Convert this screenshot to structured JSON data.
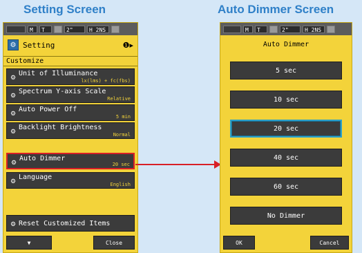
{
  "captions": {
    "left": "Setting Screen",
    "right": "Auto Dimmer Screen"
  },
  "colors": {
    "background": "#d5e7f7",
    "screen": "#f3d33a",
    "button": "#3b3b3b",
    "highlight": "#d81f26",
    "selected": "#2ca0c8",
    "caption": "#2f80c8"
  },
  "statusbar": {
    "mode": "M",
    "t": "T",
    "shutter": "2\"",
    "iso": "H 2NS"
  },
  "setting": {
    "title": "Setting",
    "title_icon": "setting-icon",
    "info_icon": "info-icon",
    "section": "Customize",
    "items": [
      {
        "label": "Unit of Illuminance",
        "value": "lx(lms) + fc(fbs)"
      },
      {
        "label": "Spectrum Y-axis Scale",
        "value": "Relative"
      },
      {
        "label": "Auto Power Off",
        "value": "5 min"
      },
      {
        "label": "Backlight Brightness",
        "value": "Normal"
      },
      {
        "label": "Auto Dimmer",
        "value": "20 sec"
      },
      {
        "label": "Language",
        "value": "English"
      }
    ],
    "reset_label": "Reset Customized Items",
    "down_button": "▼",
    "close_button": "Close"
  },
  "dimmer": {
    "title": "Auto Dimmer",
    "options": [
      "5 sec",
      "10 sec",
      "20 sec",
      "40 sec",
      "60 sec",
      "No Dimmer"
    ],
    "selected": "20 sec",
    "ok_button": "OK",
    "cancel_button": "Cancel"
  }
}
